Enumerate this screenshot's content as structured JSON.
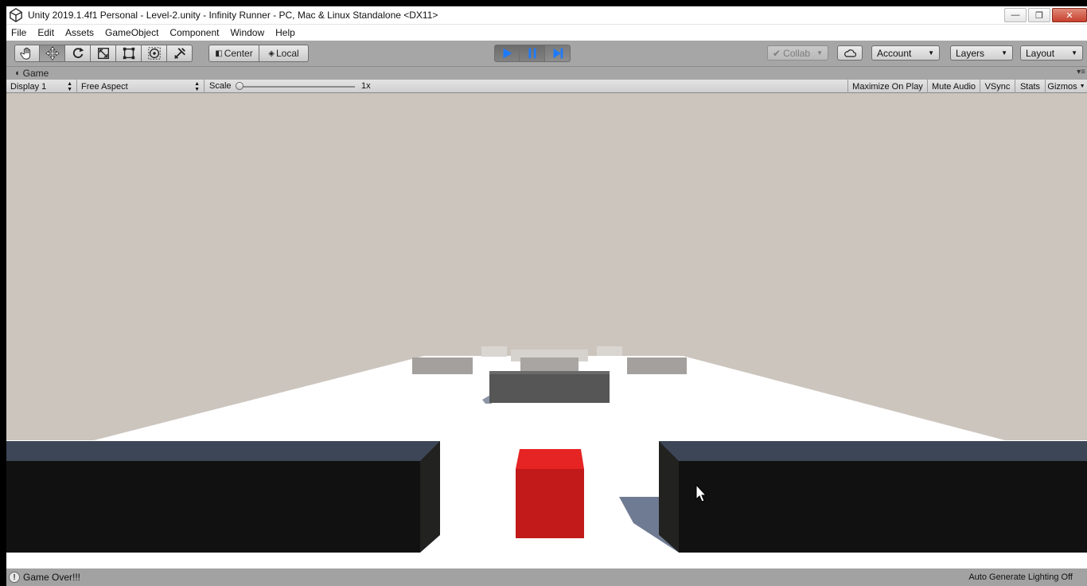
{
  "window": {
    "title": "Unity 2019.1.4f1 Personal - Level-2.unity - Infinity Runner - PC, Mac & Linux Standalone <DX11>",
    "controls": {
      "minimize": "—",
      "restore": "❐",
      "close": "✕"
    }
  },
  "menu": [
    "File",
    "Edit",
    "Assets",
    "GameObject",
    "Component",
    "Window",
    "Help"
  ],
  "toolbar": {
    "tools": [
      "hand-tool",
      "move-tool",
      "rotate-tool",
      "scale-tool",
      "rect-tool",
      "transform-tool",
      "custom-tool"
    ],
    "pivot_mode": "Center",
    "pivot_rotation": "Local",
    "play": {
      "playing": true,
      "paused": true
    },
    "collab": "Collab",
    "account": "Account",
    "layers": "Layers",
    "layout": "Layout"
  },
  "game_tab": {
    "label": "Game"
  },
  "game_bar": {
    "display": "Display 1",
    "aspect": "Free Aspect",
    "scale_label": "Scale",
    "scale_value": "1x",
    "toggles": [
      "Maximize On Play",
      "Mute Audio",
      "VSync",
      "Stats",
      "Gizmos"
    ]
  },
  "colors": {
    "sky": "#ccc5be",
    "ground": "#ffffff",
    "player_cube": "#c21a1a",
    "wall": "#101110",
    "obstacle": "#555555",
    "play_blue": "#1d7bff"
  },
  "status": {
    "message": "Game Over!!!",
    "lighting": "Auto Generate Lighting Off"
  }
}
